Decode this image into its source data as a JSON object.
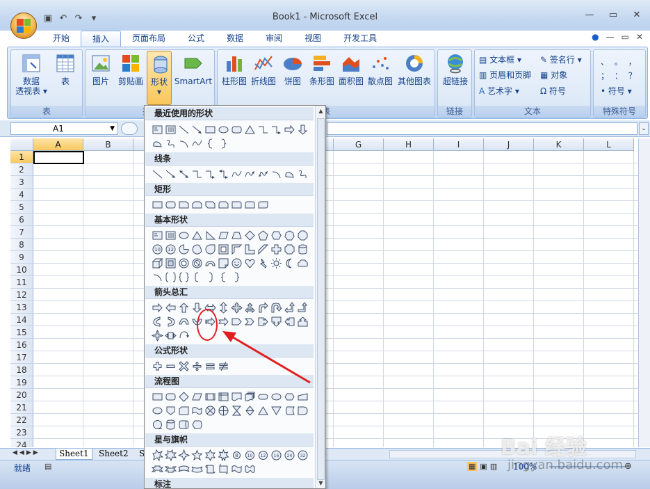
{
  "window": {
    "title": "Book1 - Microsoft Excel"
  },
  "quick_access": {
    "save_icon": "save-icon",
    "undo_icon": "undo-icon",
    "redo_icon": "redo-icon"
  },
  "tabs": [
    "开始",
    "插入",
    "页面布局",
    "公式",
    "数据",
    "审阅",
    "视图",
    "开发工具"
  ],
  "active_tab": "插入",
  "ribbon": {
    "table_group": {
      "label": "表",
      "pivot_label": "数据\n透视表",
      "pivot_line1": "数据",
      "pivot_line2": "透视表 ▾",
      "table_label": "表"
    },
    "illus_group": {
      "label": "插",
      "picture": "图片",
      "clipart": "剪贴画",
      "shapes": "形状",
      "shapes_arrow": "▾",
      "smartart": "SmartArt"
    },
    "charts_group": {
      "label": "表",
      "column": "柱形图",
      "line": "折线图",
      "pie": "饼图",
      "bar": "条形图",
      "area": "面积图",
      "scatter": "散点图",
      "other": "其他图表"
    },
    "links_group": {
      "label": "链接",
      "hyperlink": "超链接"
    },
    "text_group": {
      "label": "文本",
      "textbox": "文本框 ▾",
      "header_footer": "页眉和页脚",
      "wordart": "艺术字 ▾",
      "signature": "签名行 ▾",
      "object": "对象",
      "symbol": "Ω 符号"
    },
    "special_group": {
      "label": "特殊符号",
      "symbol": "符号 ▾",
      "row1": "、 。 ，",
      "row2": "； ： ？"
    }
  },
  "formula_bar": {
    "name_box": "A1",
    "formula": ""
  },
  "columns": [
    "A",
    "B",
    "C",
    "D",
    "E",
    "F",
    "G",
    "H",
    "I",
    "J",
    "K",
    "L"
  ],
  "rows": [
    "1",
    "2",
    "3",
    "4",
    "5",
    "6",
    "7",
    "8",
    "9",
    "10",
    "11",
    "12",
    "13",
    "14",
    "15",
    "16",
    "17",
    "18",
    "19",
    "20",
    "21",
    "22",
    "23",
    "24"
  ],
  "sheets": [
    "Sheet1",
    "Sheet2",
    "S"
  ],
  "status": {
    "ready": "就绪",
    "zoom": "100%"
  },
  "shapes_menu": {
    "categories": [
      "最近使用的形状",
      "线条",
      "矩形",
      "基本形状",
      "箭头总汇",
      "公式形状",
      "流程图",
      "星与旗帜",
      "标注"
    ]
  },
  "watermark": {
    "brand": "Bai 经验",
    "url": "jingyan.baidu.com"
  },
  "colors": {
    "ribbon_bg": "#cfdef2",
    "accent": "#15428b",
    "annotation": "#e02020",
    "selected_header": "#f8c860"
  }
}
